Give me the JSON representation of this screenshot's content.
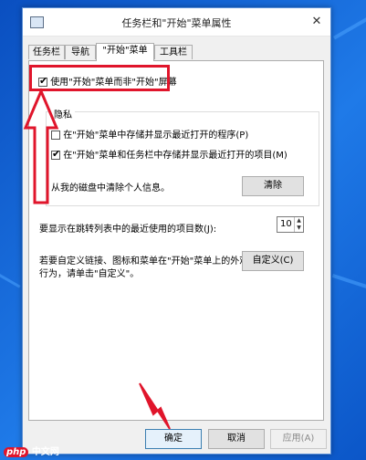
{
  "window": {
    "title": "任务栏和\"开始\"菜单属性",
    "close_glyph": "✕"
  },
  "tabs": [
    {
      "label": "任务栏"
    },
    {
      "label": "导航"
    },
    {
      "label": "\"开始\"菜单"
    },
    {
      "label": "工具栏"
    }
  ],
  "start_screen_option": {
    "label": "使用\"开始\"菜单而非\"开始\"屏幕",
    "checked": true
  },
  "privacy": {
    "group_label": "隐私",
    "store_programs": "在\"开始\"菜单中存储并显示最近打开的程序(P)",
    "store_items": "在\"开始\"菜单和任务栏中存储并显示最近打开的项目(M)",
    "clear_text": "从我的磁盘中清除个人信息。",
    "clear_button": "清除"
  },
  "jump_list": {
    "label": "要显示在跳转列表中的最近使用的项目数(J):",
    "value": "10"
  },
  "customize": {
    "text_line1": "若要自定义链接、图标和菜单在\"开始\"菜单上的外观和",
    "text_line2": "行为，请单击\"自定义\"。",
    "button": "自定义(C)"
  },
  "footer": {
    "ok": "确定",
    "cancel": "取消",
    "apply": "应用(A)"
  },
  "watermark": {
    "badge": "php",
    "text": "中文网"
  },
  "colors": {
    "annotation_red": "#e0152b",
    "desktop_blue": "#1f7ae8"
  }
}
